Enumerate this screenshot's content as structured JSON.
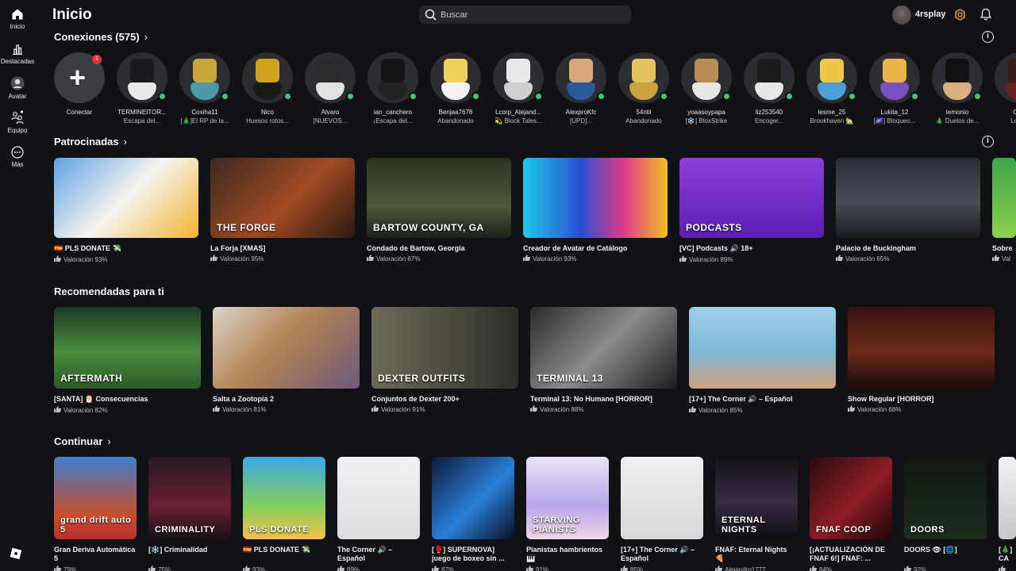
{
  "nav": {
    "items": [
      {
        "label": "Inicio",
        "icon": "home-icon"
      },
      {
        "label": "Destacadas",
        "icon": "chart-icon"
      },
      {
        "label": "Avatar",
        "icon": "avatar-icon"
      },
      {
        "label": "Equipo",
        "icon": "team-icon"
      },
      {
        "label": "Más",
        "icon": "more-icon"
      }
    ]
  },
  "header": {
    "title": "Inicio",
    "search_placeholder": "Buscar",
    "username": "4rsplay"
  },
  "connections": {
    "title": "Conexiones (575)",
    "connect_label": "Conectar",
    "connect_badge": "1",
    "friends": [
      {
        "name": "TERMINEITOR...",
        "status": "Escapa del...",
        "head": "#1b1b1d",
        "body": "#e8e8e8"
      },
      {
        "name": "Coxiha11",
        "status": "[🎄]El RP de la...",
        "head": "#c9a53a",
        "body": "#4f9aa8"
      },
      {
        "name": "Nico",
        "status": "Huesos rotos...",
        "head": "#d0a21f",
        "body": "#1a1a1a"
      },
      {
        "name": "Alvaro",
        "status": "[NUEVOS...",
        "head": "#2a2a2a",
        "body": "#e2e2e2"
      },
      {
        "name": "ian_canchero",
        "status": "¡Escapa del...",
        "head": "#151515",
        "body": "#222"
      },
      {
        "name": "Benjaa7678",
        "status": "Abandonado",
        "head": "#f0d25a",
        "body": "#f2f2f2"
      },
      {
        "name": "Lcorp_Alejand...",
        "status": "💫 Block Tales...",
        "head": "#e9e9e9",
        "body": "#cfcfcf"
      },
      {
        "name": "AlexproKfc",
        "status": "[UPD]...",
        "head": "#d9a878",
        "body": "#2b5a9a"
      },
      {
        "name": "54ntii",
        "status": "Abandonado",
        "head": "#e3c25d",
        "body": "#c9a43f"
      },
      {
        "name": "yoaasoypapa",
        "status": "[❄️] BloxStrike",
        "head": "#b58e5a",
        "body": "#e6e6e6"
      },
      {
        "name": "liz253540",
        "status": "Encoger...",
        "head": "#1d1d1d",
        "body": "#e7e7e7"
      },
      {
        "name": "lesme_25",
        "status": "Brookhaven 🏡",
        "head": "#f1c74a",
        "body": "#4aa1d8"
      },
      {
        "name": "Lukita_12",
        "status": "[🌌] Bloqueo...",
        "head": "#e9b54a",
        "body": "#7a4fc0"
      },
      {
        "name": "temonio",
        "status": "🎄 Duelos de...",
        "head": "#111",
        "body": "#d9b07e"
      },
      {
        "name": "Okar",
        "status": "Los ca",
        "head": "#3a1a1a",
        "body": "#6a2020"
      }
    ]
  },
  "sponsored": {
    "title": "Patrocinadas",
    "games": [
      {
        "title": "🇪🇸 PLS DONATE 💸",
        "rating": "Valoración 93%",
        "bg": "linear-gradient(135deg,#5fa2e3,#f6f3ee 50%,#f3b431)",
        "overlay": ""
      },
      {
        "title": "La Forja [XMAS]",
        "rating": "Valoración 95%",
        "bg": "linear-gradient(135deg,#3b2a20,#a24a22 55%,#2a1a14)",
        "overlay": "THE FORGE"
      },
      {
        "title": "Condado de Bartow, Georgia",
        "rating": "Valoración 67%",
        "bg": "linear-gradient(180deg,#2a3320,#4d5a3b 60%,#1b2218)",
        "overlay": "BARTOW COUNTY, GA"
      },
      {
        "title": "Creador de Avatar de Catálogo",
        "rating": "Valoración 93%",
        "bg": "linear-gradient(90deg,#20c9e8,#2a4fd0 40%,#e23a8a 70%,#f0c020)",
        "overlay": ""
      },
      {
        "title": "[VC] Podcasts 🔊 18+",
        "rating": "Valoración 89%",
        "bg": "linear-gradient(180deg,#8c3ed8,#5a1fb4)",
        "overlay": "PODCASTS"
      },
      {
        "title": "Palacio de Buckingham",
        "rating": "Valoración 65%",
        "bg": "linear-gradient(180deg,#2a2d38,#4a4c58 55%,#1a1b22)",
        "overlay": ""
      },
      {
        "title": "Sobre",
        "rating": "Val",
        "bg": "linear-gradient(180deg,#3ba548,#8fd14f)",
        "overlay": ""
      }
    ]
  },
  "recommended": {
    "title": "Recomendadas para ti",
    "games": [
      {
        "title": "[SANTA] 🎅 Consecuencias",
        "rating": "Valoración 82%",
        "bg": "linear-gradient(180deg,#1d3a22,#4b8c3c 55%,#2d5a28)",
        "overlay": "AFTERMATH"
      },
      {
        "title": "Salta a Zootopia 2",
        "rating": "Valoración 81%",
        "bg": "linear-gradient(135deg,#d9d4c8,#b58454 45%,#6b5a7c)",
        "overlay": ""
      },
      {
        "title": "Conjuntos de Dexter 200+",
        "rating": "Valoración 91%",
        "bg": "linear-gradient(90deg,#6e6a58,#2c2e27)",
        "overlay": "DEXTER OUTFITS"
      },
      {
        "title": "Terminal 13: No Humano [HORROR]",
        "rating": "Valoración 88%",
        "bg": "linear-gradient(135deg,#2a2a2a,#8c8c8c 50%,#1c1c1c)",
        "overlay": "TERMINAL 13"
      },
      {
        "title": "[17+] The Corner 🔊 – Español",
        "rating": "Valoración 85%",
        "bg": "linear-gradient(180deg,#9fd0ea,#7fb6d8 55%,#cfa27a)",
        "overlay": ""
      },
      {
        "title": "Show Regular [HORROR]",
        "rating": "Valoración 68%",
        "bg": "linear-gradient(180deg,#3a1410,#6b2a18 55%,#1c0a08)",
        "overlay": ""
      }
    ]
  },
  "continue": {
    "title": "Continuar",
    "games": [
      {
        "title": "Gran Deriva Automática 5",
        "rating": "79%",
        "bg": "linear-gradient(180deg,#3f7fd0,#c94f2c 70%,#b82f2f)",
        "overlay": "grand drift auto 5"
      },
      {
        "title": "[❄️] Criminalidad",
        "rating": "75%",
        "bg": "linear-gradient(180deg,#271a22,#6a2032 60%,#1a1016)",
        "overlay": "CRIMINALITY"
      },
      {
        "title": "🇪🇸 PLS DONATE 💸",
        "rating": "93%",
        "bg": "linear-gradient(180deg,#3aa7e8,#86cf5c 60%,#f2c14a)",
        "overlay": "PLS DONATE"
      },
      {
        "title": "The Corner 🔊 – Español",
        "rating": "89%",
        "bg": "linear-gradient(180deg,#f2f2f2,#dcdcdc)",
        "overlay": ""
      },
      {
        "title": "[🥊] SUPERNOVA] juego de boxeo sin ...",
        "rating": "87%",
        "bg": "linear-gradient(135deg,#0e1a3a,#2a7fd8 55%,#0a0f22)",
        "overlay": ""
      },
      {
        "title": "Pianistas hambrientos 🎹",
        "rating": "91%",
        "bg": "linear-gradient(180deg,#e8e3f5,#b8a6ea 60%,#f2d6e9)",
        "overlay": "STARVING PIANISTS"
      },
      {
        "title": "[17+] The Corner 🔊 – Español",
        "rating": "85%",
        "bg": "linear-gradient(180deg,#efefef,#d8d8d8)",
        "overlay": ""
      },
      {
        "title": "FNAF: Eternal Nights 🍕",
        "rating": "Alejandro1777",
        "bg": "linear-gradient(180deg,#141418,#3a2a44 55%,#0e0e12)",
        "overlay": "ETERNAL NIGHTS"
      },
      {
        "title": "[¡ACTUALIZACIÓN DE FNAF 6!] FNAF: ...",
        "rating": "84%",
        "bg": "linear-gradient(135deg,#2a0c10,#8e1c24 55%,#1a0608)",
        "overlay": "FNAF COOP"
      },
      {
        "title": "DOORS 👁 [🌐]",
        "rating": "92%",
        "bg": "linear-gradient(180deg,#0f1a0f,#1c2e1c)",
        "overlay": "DOORS"
      },
      {
        "title": "[🎄] CA",
        "rating": "",
        "bg": "linear-gradient(180deg,#f0f0f0,#c8c8c8)",
        "overlay": ""
      }
    ]
  },
  "colors": {
    "background": "#111216",
    "online": "#3fc774",
    "badge": "#e3333a"
  }
}
